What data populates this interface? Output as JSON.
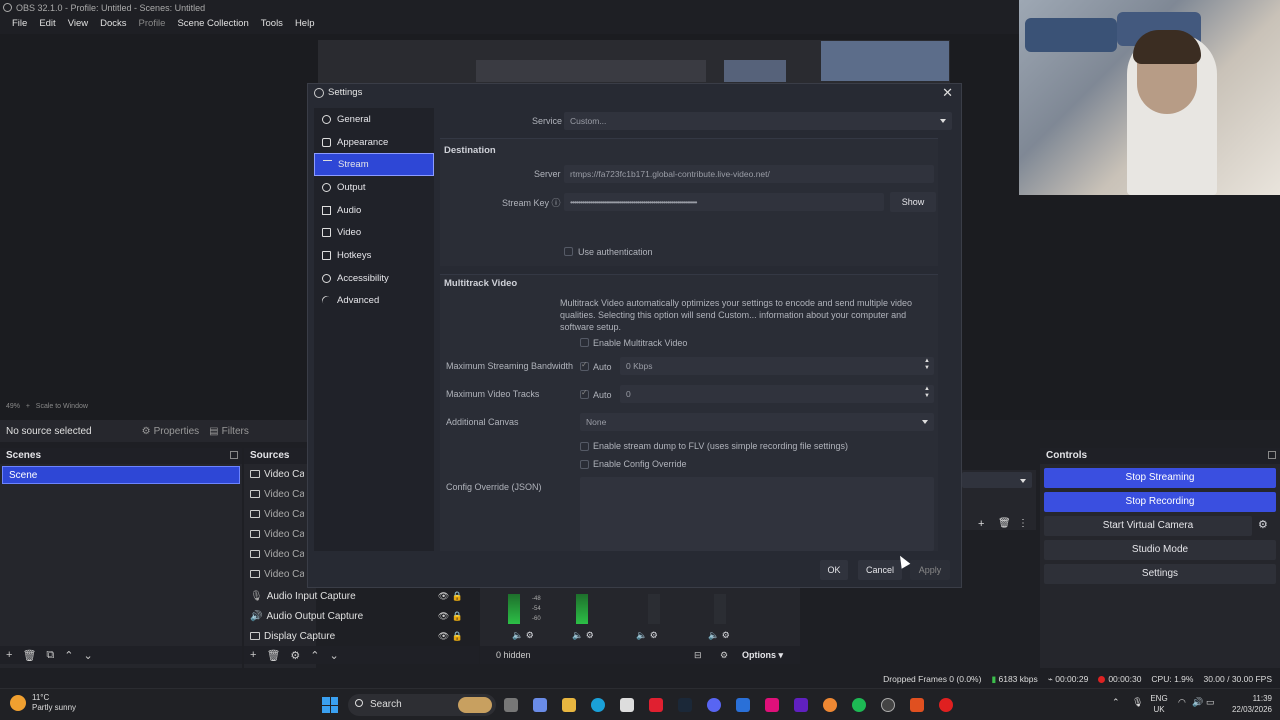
{
  "window": {
    "title": "OBS 32.1.0 - Profile: Untitled - Scenes: Untitled"
  },
  "menu": [
    "File",
    "Edit",
    "View",
    "Docks",
    "Profile",
    "Scene Collection",
    "Tools",
    "Help"
  ],
  "preview": {
    "zoom": "49%",
    "scale_mode": "Scale to Window"
  },
  "source_toolbar": {
    "no_source": "No source selected",
    "properties": "Properties",
    "filters": "Filters"
  },
  "scenes": {
    "header": "Scenes",
    "items": [
      "Scene"
    ]
  },
  "sources": {
    "header": "Sources",
    "items": [
      "Video Capture Device",
      "Video Capture Device",
      "Video Capture Device",
      "Video Capture Device",
      "Video Capture Device",
      "Video Capture Device"
    ],
    "audio_items": [
      "Audio Input Capture",
      "Audio Output Capture",
      "Display Capture"
    ]
  },
  "mixer": {
    "hidden_count": "0 hidden",
    "options": "Options",
    "ticks": [
      "-48",
      "-54",
      "-60"
    ]
  },
  "controls": {
    "header": "Controls",
    "buttons": [
      "Stop Streaming",
      "Stop Recording",
      "Start Virtual Camera",
      "Studio Mode",
      "Settings"
    ]
  },
  "status": {
    "dropped": "Dropped Frames 0 (0.0%)",
    "bitrate": "6183 kbps",
    "stream_time": "00:00:29",
    "rec_time": "00:00:30",
    "cpu": "CPU: 1.9%",
    "fps": "30.00 / 30.00 FPS"
  },
  "taskbar": {
    "weather_temp": "11°C",
    "weather_desc": "Partly sunny",
    "search": "Search",
    "lang1": "ENG",
    "lang2": "UK",
    "time": "11:39",
    "date": "22/03/2026"
  },
  "settings": {
    "title": "Settings",
    "nav": [
      "General",
      "Appearance",
      "Stream",
      "Output",
      "Audio",
      "Video",
      "Hotkeys",
      "Accessibility",
      "Advanced"
    ],
    "active_nav": "Stream",
    "service_label": "Service",
    "service_value": "Custom...",
    "destination_header": "Destination",
    "server_label": "Server",
    "server_value": "rtmps://fa723fc1b171.global-contribute.live-video.net/",
    "stream_key_label": "Stream Key",
    "stream_key_value": "••••••••••••••••••••••••••••••••••••••••••••••••••••••••••••••••",
    "show_button": "Show",
    "use_auth": "Use authentication",
    "multitrack_header": "Multitrack Video",
    "multitrack_desc": "Multitrack Video automatically optimizes your settings to encode and send multiple video qualities. Selecting this option will send Custom... information about your computer and software setup.",
    "enable_multitrack": "Enable Multitrack Video",
    "max_bandwidth_label": "Maximum Streaming Bandwidth",
    "max_bandwidth_auto": "Auto",
    "max_bandwidth_value": "0 Kbps",
    "max_tracks_label": "Maximum Video Tracks",
    "max_tracks_auto": "Auto",
    "max_tracks_value": "0",
    "additional_canvas_label": "Additional Canvas",
    "additional_canvas_value": "None",
    "stream_dump": "Enable stream dump to FLV (uses simple recording file settings)",
    "config_override": "Enable Config Override",
    "config_override_json_label": "Config Override (JSON)",
    "ok": "OK",
    "cancel": "Cancel",
    "apply": "Apply"
  },
  "colors": {
    "accent": "#2e47d6",
    "background": "#1e1f24",
    "dialog": "#272a33"
  }
}
